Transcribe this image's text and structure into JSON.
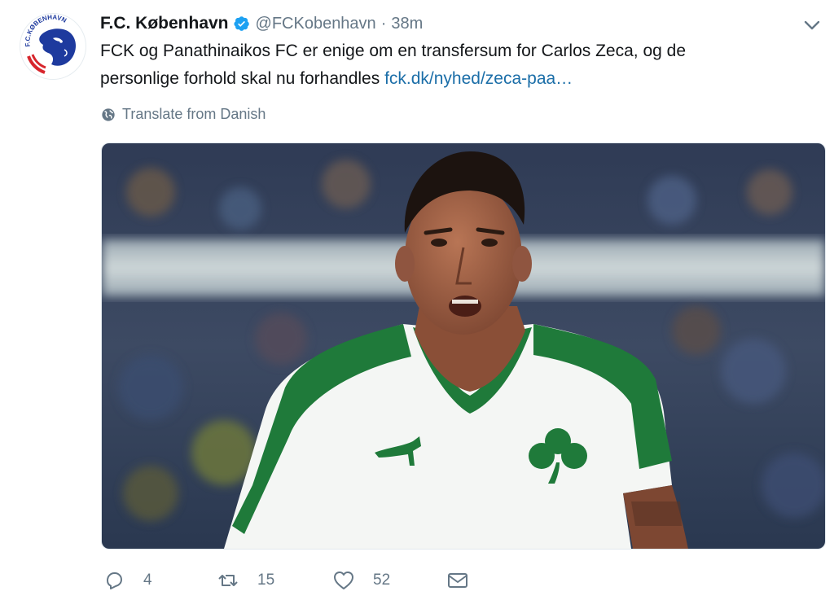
{
  "account": {
    "display_name": "F.C. København",
    "handle": "@FCKobenhavn",
    "separator": "·",
    "time": "38m",
    "avatar_text": "F.C.KØBENHAVN"
  },
  "tweet": {
    "line1": "FCK og Panathinaikos FC er enige om en transfersum for Carlos Zeca, og de",
    "line2_text": "personlige forhold skal nu forhandles ",
    "link_text": "fck.dk/nyhed/zeca-paa…",
    "translate_label": "Translate from Danish"
  },
  "actions": {
    "replies": "4",
    "retweets": "15",
    "likes": "52"
  },
  "colors": {
    "link": "#1b6ea8",
    "verified": "#1da1f2",
    "muted": "#657786",
    "club_blue": "#1e3a9e",
    "club_red": "#d7262d",
    "jersey_green": "#1f7a3a"
  },
  "icons": [
    "verified-icon",
    "chevron-down-icon",
    "globe-icon",
    "reply-icon",
    "retweet-icon",
    "heart-icon",
    "envelope-icon"
  ]
}
